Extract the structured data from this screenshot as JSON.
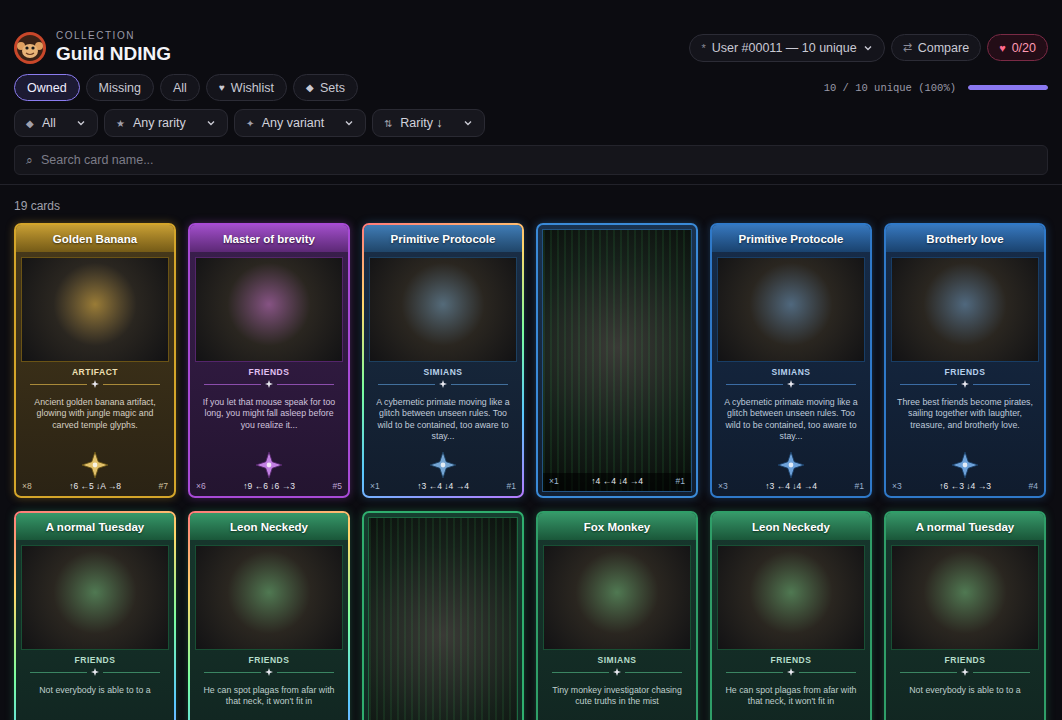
{
  "header": {
    "eyebrow": "COLLECTION",
    "title": "Guild NDING"
  },
  "user_select": {
    "icon": "*",
    "label": "User #00011 — 10 unique"
  },
  "compare_button": {
    "icon": "⇄",
    "label": "Compare"
  },
  "wishlist_counter": {
    "icon": "♥",
    "label": "0/20"
  },
  "tabs": [
    {
      "label": "Owned",
      "selected": true
    },
    {
      "label": "Missing",
      "selected": false
    },
    {
      "label": "All",
      "selected": false
    },
    {
      "label": "Wishlist",
      "icon": "♥",
      "selected": false
    },
    {
      "label": "Sets",
      "icon": "◆",
      "selected": false
    }
  ],
  "progress": {
    "label": "10 / 10 unique (100%)",
    "level": 1
  },
  "filters": [
    {
      "icon": "◆",
      "label": "All"
    },
    {
      "icon": "★",
      "label": "Any rarity"
    },
    {
      "icon": "✦",
      "label": "Any variant"
    },
    {
      "icon": "⇅",
      "label": "Rarity ↓"
    }
  ],
  "search": {
    "icon": "⌕",
    "placeholder": "Search card name..."
  },
  "count_label": "19 cards",
  "cards": [
    {
      "kind": "standard",
      "title": "Golden Banana",
      "color": "#d4a52a",
      "holo": false,
      "category": "ARTIFACT",
      "description": "Ancient golden banana artifact, glowing with jungle magic and carved temple glyphs.",
      "count": "×8",
      "stats": "↑6 ←5 ↓A →8",
      "number": "#7"
    },
    {
      "kind": "standard",
      "title": "Master of brevity",
      "color": "#a84ad6",
      "holo": false,
      "category": "FRIENDS",
      "description": "If you let that mouse speak for too long, you might fall asleep before you realize it...",
      "count": "×6",
      "stats": "↑9 ←6 ↓6 →3",
      "number": "#5"
    },
    {
      "kind": "standard",
      "title": "Primitive Protocole",
      "color": "#3a7fc0",
      "holo": true,
      "category": "SIMIANS",
      "description": "A cybernetic primate moving like a glitch between unseen rules. Too wild to be contained, too aware to stay...",
      "count": "×1",
      "stats": "↑3 ←4 ↓4 →4",
      "number": "#1"
    },
    {
      "kind": "fullart",
      "color": "#3a8ad8",
      "holo": false,
      "count": "×1",
      "stats": "↑4 ←4 ↓4 →4",
      "number": "#1"
    },
    {
      "kind": "standard",
      "title": "Primitive Protocole",
      "color": "#2f79c9",
      "holo": false,
      "category": "SIMIANS",
      "description": "A cybernetic primate moving like a glitch between unseen rules. Too wild to be contained, too aware to stay...",
      "count": "×3",
      "stats": "↑3 ←4 ↓4 →4",
      "number": "#1"
    },
    {
      "kind": "standard",
      "title": "Brotherly love",
      "color": "#2f79c9",
      "holo": false,
      "category": "FRIENDS",
      "description": "Three best friends become pirates, sailing together with laughter, treasure, and brotherly love.",
      "count": "×3",
      "stats": "↑6 ←3 ↓4 →3",
      "number": "#4"
    },
    {
      "kind": "standard",
      "title": "A normal Tuesday",
      "color": "#2f9e68",
      "holo": true,
      "category": "FRIENDS",
      "description": "Not everybody is able to to a"
    },
    {
      "kind": "standard",
      "title": "Leon Neckedy",
      "color": "#2f9e68",
      "holo": true,
      "category": "FRIENDS",
      "description": "He can spot plagas from afar with that neck, it won't fit in"
    },
    {
      "kind": "fullart",
      "color": "#2fae6e",
      "holo": false
    },
    {
      "kind": "standard",
      "title": "Fox Monkey",
      "color": "#2f9e68",
      "holo": false,
      "category": "SIMIANS",
      "description": "Tiny monkey investigator chasing cute truths in the mist"
    },
    {
      "kind": "standard",
      "title": "Leon Neckedy",
      "color": "#2f9e68",
      "holo": false,
      "category": "FRIENDS",
      "description": "He can spot plagas from afar with that neck, it won't fit in"
    },
    {
      "kind": "standard",
      "title": "A normal Tuesday",
      "color": "#2f9e68",
      "holo": false,
      "category": "FRIENDS",
      "description": "Not everybody is able to to a"
    }
  ]
}
